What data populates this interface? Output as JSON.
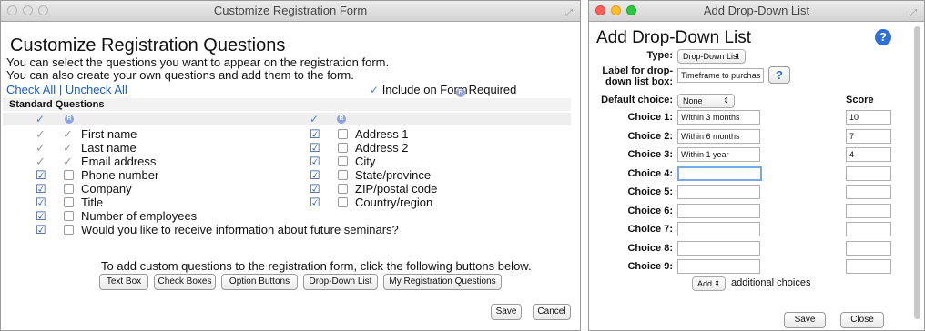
{
  "win1": {
    "title": "Customize Registration Form",
    "heading": "Customize Registration Questions",
    "intro_line1": "You can select the questions you want to appear on the registration form.",
    "intro_line2": "You can also create your own questions and add them to the form.",
    "check_all": "Check All",
    "separator": "|",
    "uncheck_all": "Uncheck All",
    "legend_include": "Include on Form",
    "legend_required": "Required",
    "section_title": "Standard Questions",
    "left_questions": [
      {
        "label": "First name",
        "include": "locked",
        "required": "locked"
      },
      {
        "label": "Last name",
        "include": "locked",
        "required": "locked"
      },
      {
        "label": "Email address",
        "include": "locked",
        "required": "locked"
      },
      {
        "label": "Phone number",
        "include": "checked",
        "required": "unchecked"
      },
      {
        "label": "Company",
        "include": "checked",
        "required": "unchecked"
      },
      {
        "label": "Title",
        "include": "checked",
        "required": "unchecked"
      },
      {
        "label": "Number of employees",
        "include": "checked",
        "required": "unchecked"
      },
      {
        "label": "Would you like to receive information about future seminars?",
        "include": "checked",
        "required": "unchecked"
      }
    ],
    "right_questions": [
      {
        "label": "Address 1",
        "include": "checked",
        "required": "unchecked"
      },
      {
        "label": "Address 2",
        "include": "checked",
        "required": "unchecked"
      },
      {
        "label": "City",
        "include": "checked",
        "required": "unchecked"
      },
      {
        "label": "State/province",
        "include": "checked",
        "required": "unchecked"
      },
      {
        "label": "ZIP/postal code",
        "include": "checked",
        "required": "unchecked"
      },
      {
        "label": "Country/region",
        "include": "checked",
        "required": "unchecked"
      }
    ],
    "custom_prompt": "To add custom questions to the registration form, click the following buttons below.",
    "buttons": [
      "Text Box",
      "Check Boxes",
      "Option Buttons",
      "Drop-Down List",
      "My Registration Questions"
    ],
    "save": "Save",
    "cancel": "Cancel"
  },
  "win2": {
    "title": "Add Drop-Down List",
    "heading": "Add Drop-Down List",
    "help": "?",
    "type_label": "Type:",
    "type_value": "Drop-Down List",
    "label_line1": "Label for drop-",
    "label_line2": "down list box:",
    "label_value": "Timeframe to purchas",
    "label_help": "?",
    "default_label": "Default choice:",
    "default_value": "None",
    "score_header": "Score",
    "choices": [
      {
        "label": "Choice 1:",
        "value": "Within 3 months",
        "score": "10"
      },
      {
        "label": "Choice 2:",
        "value": "Within 6 months",
        "score": "7"
      },
      {
        "label": "Choice 3:",
        "value": "Within 1 year",
        "score": "4"
      },
      {
        "label": "Choice 4:",
        "value": "",
        "score": ""
      },
      {
        "label": "Choice 5:",
        "value": "",
        "score": ""
      },
      {
        "label": "Choice 6:",
        "value": "",
        "score": ""
      },
      {
        "label": "Choice 7:",
        "value": "",
        "score": ""
      },
      {
        "label": "Choice 8:",
        "value": "",
        "score": ""
      },
      {
        "label": "Choice 9:",
        "value": "",
        "score": ""
      }
    ],
    "add_value": "Add",
    "add_suffix": "additional choices",
    "save": "Save",
    "close": "Close"
  },
  "colors": {
    "link": "#1a5bc4",
    "checkbox": "#24509c",
    "required_badge": "#8fa2e0",
    "help": "#2f6fd6"
  }
}
